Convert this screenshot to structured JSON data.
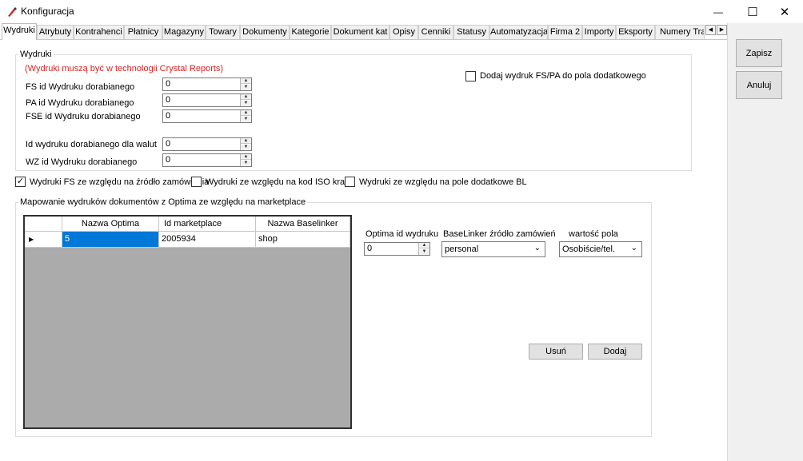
{
  "window": {
    "title": "Konfiguracja",
    "minimize_glyph": "—",
    "maximize_glyph": "☐",
    "close_glyph": "✕"
  },
  "tabs": [
    "Wydruki",
    "Atrybuty",
    "Kontrahenci",
    "Płatnicy",
    "Magazyny",
    "Towary",
    "Dokumenty",
    "Kategorie",
    "Dokument kat",
    "Opisy",
    "Cenniki",
    "Statusy",
    "Automatyzacja",
    "Firma 2",
    "Importy",
    "Eksporty",
    "Numery Trac"
  ],
  "tab_scroll": {
    "left": "◀",
    "right": "▶"
  },
  "actions": {
    "save": "Zapisz",
    "cancel": "Anuluj"
  },
  "wydruki_group": {
    "title": "Wydruki",
    "note": "(Wydruki muszą być w technologii Crystal Reports)",
    "fields": [
      {
        "label": "FS id Wydruku dorabianego",
        "value": "0"
      },
      {
        "label": "PA id Wydruku dorabianego",
        "value": "0"
      },
      {
        "label": "FSE id Wydruku dorabianego",
        "value": "0"
      },
      {
        "label": "Id wydruku dorabianego dla walut",
        "value": "0"
      },
      {
        "label": "WZ id Wydruku dorabianego",
        "value": "0"
      }
    ],
    "add_fs_pa_checkbox": {
      "label": "Dodaj wydruk FS/PA do pola dodatkowego",
      "checked": false
    }
  },
  "options": [
    {
      "label": "Wydruki FS ze względu na źródło zamówienia",
      "checked": true
    },
    {
      "label": "Wydruki ze względu na kod ISO kraju",
      "checked": false
    },
    {
      "label": "Wydruki ze względu na pole dodatkowe BL",
      "checked": false
    }
  ],
  "mapping_group": {
    "title": "Mapowanie wydruków dokumentów z Optima ze względu na marketplace",
    "grid": {
      "columns": [
        "Nazwa Optima",
        "Id marketplace",
        "Nazwa Baselinker"
      ],
      "row_marker": "▶",
      "rows": [
        [
          "5",
          "2005934",
          "shop"
        ]
      ]
    },
    "optima_id": {
      "label": "Optima id wydruku",
      "value": "0"
    },
    "bl_source": {
      "label": "BaseLinker źródło zamówień",
      "value": "personal"
    },
    "field_value": {
      "label": "wartość pola",
      "value": "Osobiście/tel."
    },
    "remove_button": "Usuń",
    "add_button": "Dodaj"
  },
  "colors": {
    "note_red": "#e02020",
    "selection_blue": "#0078d7",
    "grid_background": "#ababab"
  }
}
